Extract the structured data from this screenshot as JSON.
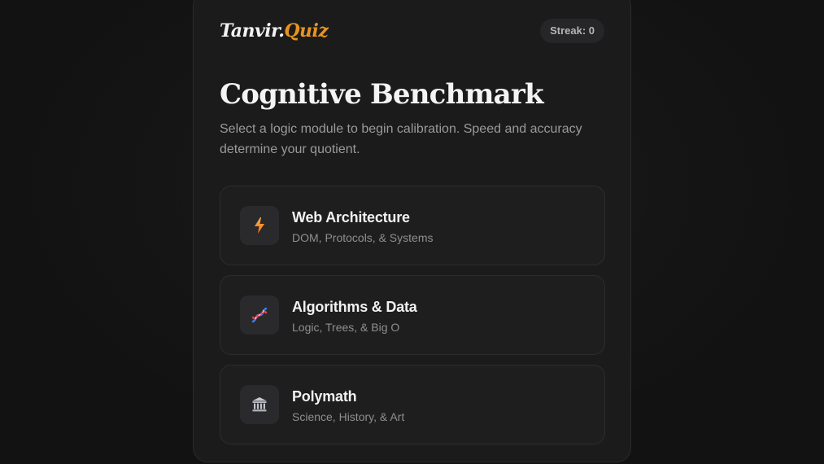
{
  "header": {
    "logo_main": "Tanvir.",
    "logo_accent": "Quiz",
    "streak": "Streak: 0"
  },
  "hero": {
    "title": "Cognitive Benchmark",
    "subtitle": "Select a logic module to begin calibration. Speed and accuracy determine your quotient."
  },
  "modules": [
    {
      "title": "Web Architecture",
      "desc": "DOM, Protocols, & Systems",
      "icon": "lightning-icon"
    },
    {
      "title": "Algorithms & Data",
      "desc": "Logic, Trees, & Big O",
      "icon": "dna-icon"
    },
    {
      "title": "Polymath",
      "desc": "Science, History, & Art",
      "icon": "classical-building-icon"
    }
  ],
  "colors": {
    "accent": "#e7941f",
    "background": "#141414",
    "card": "#1b1b1c"
  }
}
